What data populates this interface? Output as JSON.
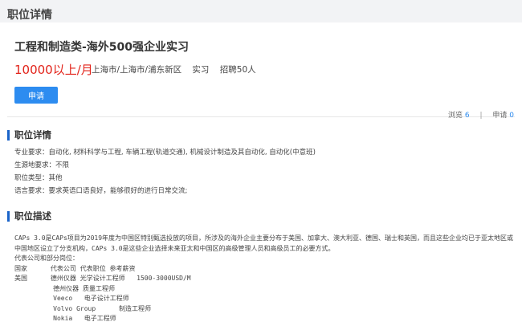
{
  "page_title": "职位详情",
  "job": {
    "title": "工程和制造类-海外500强企业实习",
    "salary": "10000以上/月",
    "location": "上海市/上海市/浦东新区",
    "type": "实习",
    "headcount": "招聘50人",
    "apply_label": "申请"
  },
  "details_section": {
    "title": "职位详情",
    "views_label": "浏览",
    "views_count": "6",
    "applies_label": "申请",
    "applies_count": "0",
    "rows": [
      {
        "label": "专业要求：",
        "value": "自动化, 材料科学与工程, 车辆工程(轨道交通), 机械设计制造及其自动化, 自动化(中意班)"
      },
      {
        "label": "生源地要求：",
        "value": "不限"
      },
      {
        "label": "职位类型：",
        "value": "其他"
      },
      {
        "label": "语言要求：",
        "value": "要求英语口语良好，能够很好的进行日常交流;"
      }
    ]
  },
  "description_section": {
    "title": "职位描述",
    "paragraph": "CAPs 3.0是CAPs项目为2019年度为中国区特别甄选投放的项目，所涉及的海外企业主要分布于美国、加拿大、澳大利亚、德国、瑞士和英国，而且这些企业均已于亚太地区或中国地区设立了分支机构，CAPs 3.0是这些企业选择未来亚太和中国区的高级管理人员和高级员工的必要方式。",
    "lines": [
      "代表公司和部分岗位：",
      "国家      代表公司 代表职位 参考薪资",
      "美国      德州仪器 光学设计工程师   1500-3000USD/M",
      "          德州仪器 质量工程师",
      "          Veeco   电子设计工程师",
      "          Volvo Group      制造工程师",
      "          Nokia   电子工程师"
    ]
  }
}
